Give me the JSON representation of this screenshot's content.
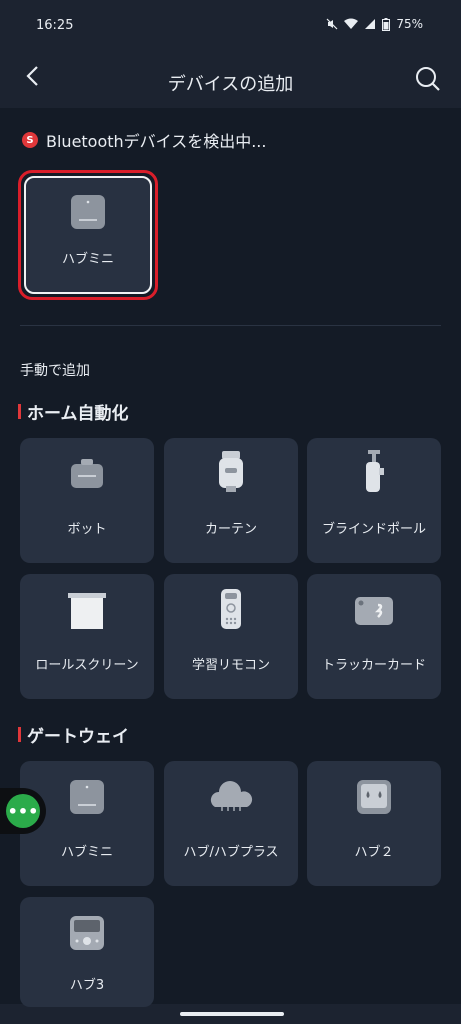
{
  "status_bar": {
    "time": "16:25",
    "battery": "75%"
  },
  "appbar": {
    "title": "デバイスの追加"
  },
  "scanning": {
    "text": "Bluetoothデバイスを検出中..."
  },
  "found": [
    {
      "label": "ハブミニ",
      "icon": "hub-mini-icon"
    }
  ],
  "manual": {
    "title": "手動で追加"
  },
  "categories": [
    {
      "title": "ホーム自動化",
      "items": [
        {
          "label": "ボット",
          "icon": "bot-icon"
        },
        {
          "label": "カーテン",
          "icon": "curtain-icon"
        },
        {
          "label": "ブラインドポール",
          "icon": "blind-tilt-icon"
        },
        {
          "label": "ロールスクリーン",
          "icon": "roller-shade-icon"
        },
        {
          "label": "学習リモコン",
          "icon": "remote-icon"
        },
        {
          "label": "トラッカーカード",
          "icon": "tracker-card-icon"
        }
      ]
    },
    {
      "title": "ゲートウェイ",
      "items": [
        {
          "label": "ハブミニ",
          "icon": "hub-mini-icon"
        },
        {
          "label": "ハブ/ハブプラス",
          "icon": "hub-plus-icon"
        },
        {
          "label": "ハブ２",
          "icon": "hub2-icon"
        },
        {
          "label": "ハブ3",
          "icon": "hub3-icon"
        }
      ]
    }
  ]
}
